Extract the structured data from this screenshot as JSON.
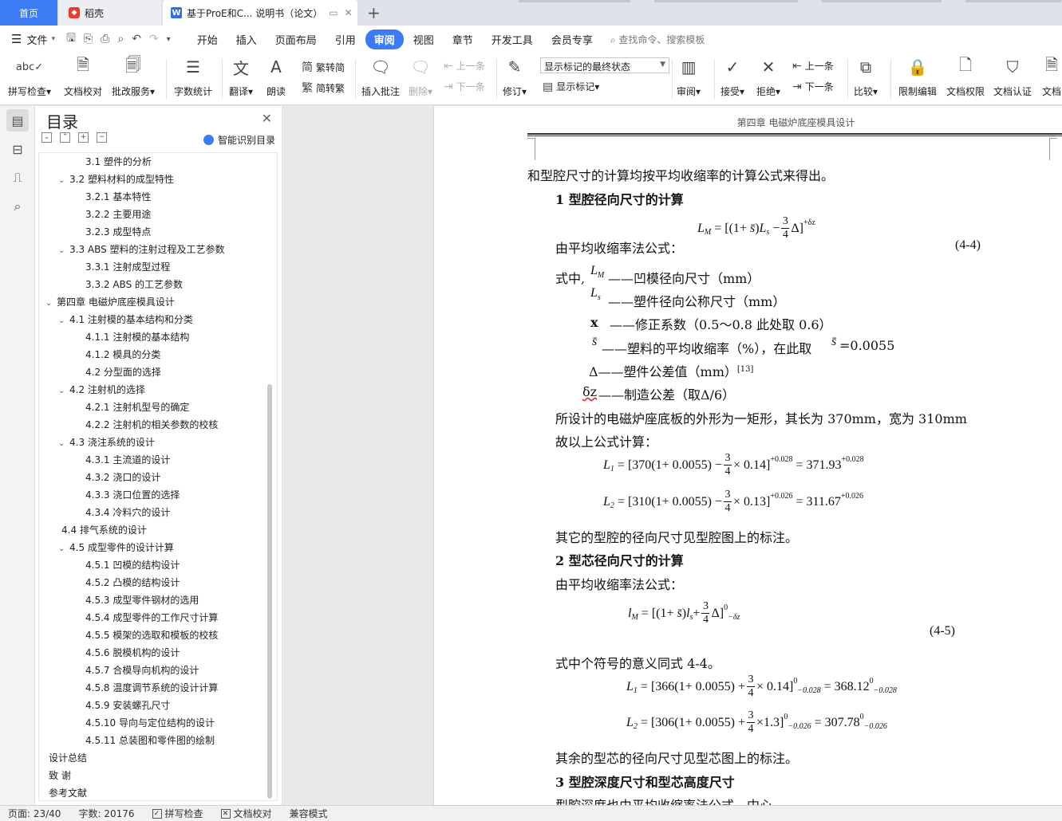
{
  "tabs": {
    "home": "首页",
    "daoke": "稻壳",
    "doc": "基于ProE和C... 说明书（论文）"
  },
  "menu": {
    "file": "文件",
    "items": [
      "开始",
      "插入",
      "页面布局",
      "引用",
      "审阅",
      "视图",
      "章节",
      "开发工具",
      "会员专享"
    ],
    "active": "审阅",
    "search": "查找命令、搜索模板"
  },
  "ribbon": {
    "spell": "拼写检查",
    "proof": "文档校对",
    "annotate_service": "批改服务",
    "word_count": "字数统计",
    "translate": "翻译",
    "read_aloud": "朗读",
    "to_traditional": "繁转简",
    "to_simplified": "简转繁",
    "insert_comment": "插入批注",
    "delete": "删除",
    "prev_comment": "上一条",
    "next_comment": "下一条",
    "revise": "修订",
    "mark_state": "显示标记的最终状态",
    "show_marks": "显示标记",
    "review": "审阅",
    "accept": "接受",
    "reject": "拒绝",
    "prev": "上一条",
    "next": "下一条",
    "compare": "比较",
    "restrict_edit": "限制编辑",
    "doc_rights": "文档权限",
    "doc_cert": "文档认证",
    "doc_more": "文档"
  },
  "toc": {
    "title": "目录",
    "smart": "智能识别目录",
    "items": [
      {
        "text": "3.1 塑件的分析",
        "level": 3,
        "tw": ""
      },
      {
        "text": "3.2  塑料材料的成型特性",
        "level": 2,
        "tw": "v"
      },
      {
        "text": "3.2.1  基本特性",
        "level": 3,
        "tw": ""
      },
      {
        "text": "3.2.2  主要用途",
        "level": 3,
        "tw": ""
      },
      {
        "text": "3.2.3  成型特点",
        "level": 3,
        "tw": ""
      },
      {
        "text": "3.3 ABS 塑料的注射过程及工艺参数",
        "level": 2,
        "tw": "v"
      },
      {
        "text": "3.3.1  注射成型过程",
        "level": 3,
        "tw": ""
      },
      {
        "text": "3.3.2 ABS 的工艺参数",
        "level": 3,
        "tw": ""
      },
      {
        "text": "第四章    电磁炉底座模具设计",
        "level": 1,
        "tw": "v"
      },
      {
        "text": "4.1 注射模的基本结构和分类",
        "level": 2,
        "tw": "v"
      },
      {
        "text": "4.1.1 注射模的基本结构",
        "level": 3,
        "tw": ""
      },
      {
        "text": "4.1.2 模具的分类",
        "level": 3,
        "tw": ""
      },
      {
        "text": "4.2 分型面的选择",
        "level": 3,
        "tw": ""
      },
      {
        "text": "4.2 注射机的选择",
        "level": 2,
        "tw": "v"
      },
      {
        "text": "4.2.1 注射机型号的确定",
        "level": 3,
        "tw": ""
      },
      {
        "text": "4.2.2 注射机的相关参数的校核",
        "level": 3,
        "tw": ""
      },
      {
        "text": "4.3 浇注系统的设计",
        "level": 2,
        "tw": "v"
      },
      {
        "text": "4.3.1  主流道的设计",
        "level": 3,
        "tw": ""
      },
      {
        "text": "4.3.2  浇口的设计",
        "level": 3,
        "tw": ""
      },
      {
        "text": "4.3.3  浇口位置的选择",
        "level": 3,
        "tw": ""
      },
      {
        "text": "4.3.4  冷料穴的设计",
        "level": 3,
        "tw": ""
      },
      {
        "text": "4.4  排气系统的设计",
        "level": 2,
        "tw": ""
      },
      {
        "text": "4.5  成型零件的设计计算",
        "level": 2,
        "tw": "v"
      },
      {
        "text": "4.5.1 凹模的结构设计",
        "level": 3,
        "tw": ""
      },
      {
        "text": "4.5.2  凸模的结构设计",
        "level": 3,
        "tw": ""
      },
      {
        "text": "4.5.3  成型零件钢材的选用",
        "level": 3,
        "tw": ""
      },
      {
        "text": "4.5.4  成型零件的工作尺寸计算",
        "level": 3,
        "tw": ""
      },
      {
        "text": "4.5.5  模架的选取和模板的校核",
        "level": 3,
        "tw": ""
      },
      {
        "text": "4.5.6  脱模机构的设计",
        "level": 3,
        "tw": ""
      },
      {
        "text": "4.5.7 合模导向机构的设计",
        "level": 3,
        "tw": ""
      },
      {
        "text": "4.5.8  温度调节系统的设计计算",
        "level": 3,
        "tw": ""
      },
      {
        "text": "4.5.9  安装螺孔尺寸",
        "level": 3,
        "tw": ""
      },
      {
        "text": "4.5.10  导向与定位结构的设计",
        "level": 3,
        "tw": ""
      },
      {
        "text": "4.5.11  总装图和零件图的绘制",
        "level": 3,
        "tw": ""
      },
      {
        "text": "设计总结",
        "level": 1,
        "tw": ""
      },
      {
        "text": "致      谢",
        "level": 1,
        "tw": ""
      },
      {
        "text": "参考文献",
        "level": 1,
        "tw": ""
      }
    ]
  },
  "document": {
    "header": "第四章    电磁炉底座模具设计",
    "line1": "和型腔尺寸的计算均按平均收缩率的计算公式来得出。",
    "h1": "1  型腔径向尺寸的计算",
    "formula_intro": "由平均收缩率法公式：",
    "eq_44": "(4-4)",
    "where": "式中,",
    "def_LM": "——凹模径向尺寸（mm）",
    "def_Ls": "——塑件径向公称尺寸（mm）",
    "def_x_sym": "x",
    "def_x": "——修正系数（0.5～0.8 此处取 0.6）",
    "def_s": "——塑料的平均收缩率（%），在此取",
    "def_s_val": "=0.0055",
    "def_delta": "Δ——塑件公差值（mm）",
    "def_delta_ref": "[13]",
    "def_dz_sym": "δz",
    "def_dz": "——制造公差（取Δ/6）",
    "design_line": "所设计的电磁炉座底板的外形为一矩形，其长为 370mm，宽为 310mm",
    "calc_line": "故以上公式计算：",
    "other_cavity": "其它的型腔的径向尺寸见型腔图上的标注。",
    "h2": "2  型芯径向尺寸的计算",
    "formula_intro2": "由平均收缩率法公式：",
    "eq_45": "(4-5)",
    "same_meaning": "式中个符号的意义同式 4-4。",
    "other_core": "其余的型芯的径向尺寸见型芯图上的标注。",
    "h3": "3  型腔深度尺寸和型芯高度尺寸",
    "last_line": "型腔深度也由平均收缩率法公式，中心"
  },
  "equations": {
    "e1a": "[370(1+ 0.0055) −",
    "e1b": "× 0.14]",
    "e1c": "= 371.93",
    "e1_tol": "+0.028",
    "e2a": "[310(1+ 0.0055) −",
    "e2b": "× 0.13]",
    "e2c": "= 311.67",
    "e2_tol": "+0.026",
    "e3a": "[366(1+ 0.0055) +",
    "e3b": "× 0.14]",
    "e3c": "= 368.12",
    "e3_tol": "−0.028",
    "e4a": "[306(1+ 0.0055) +",
    "e4b": "×1.3]",
    "e4c": "= 307.78",
    "e4_tol": "−0.026"
  },
  "status": {
    "page": "页面: 23/40",
    "words": "字数: 20176",
    "spell": "拼写检查",
    "proof": "文档校对",
    "compat": "兼容模式"
  }
}
